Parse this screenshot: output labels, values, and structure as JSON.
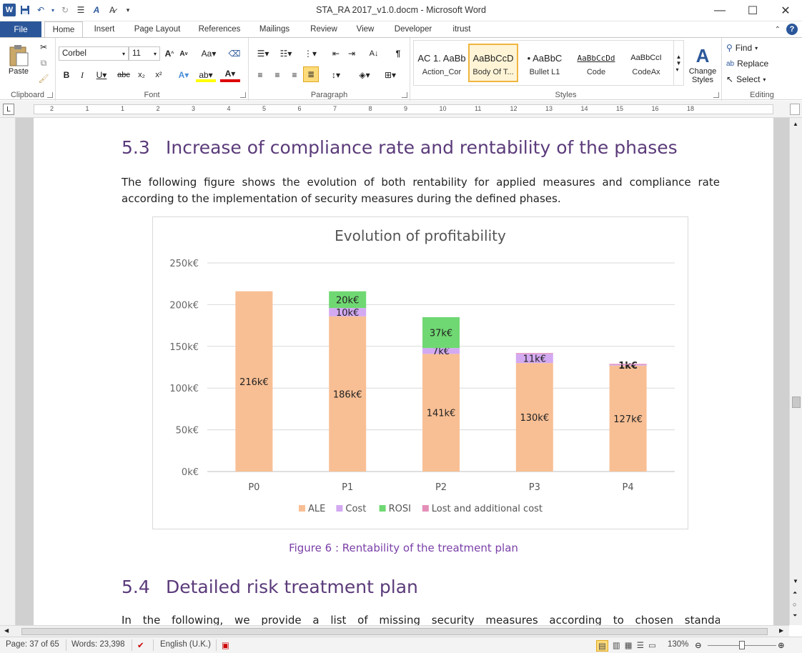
{
  "window": {
    "title": "STA_RA 2017_v1.0.docm - Microsoft Word",
    "app_icon": "W",
    "controls": {
      "minimize": "—",
      "maximize": "☐",
      "close": "✕"
    }
  },
  "tabs": {
    "file": "File",
    "items": [
      "Home",
      "Insert",
      "Page Layout",
      "References",
      "Mailings",
      "Review",
      "View",
      "Developer",
      "itrust"
    ],
    "active": "Home"
  },
  "ribbon": {
    "clipboard": {
      "label": "Clipboard",
      "paste": "Paste"
    },
    "font": {
      "label": "Font",
      "font_name": "Corbel",
      "font_size": "11"
    },
    "paragraph": {
      "label": "Paragraph"
    },
    "styles": {
      "label": "Styles",
      "tiles": [
        {
          "sample": "AC 1. AaBb",
          "name": "Action_Cor"
        },
        {
          "sample": "AaBbCcD",
          "name": "Body Of T..."
        },
        {
          "sample": "• AaBbC",
          "name": "Bullet L1"
        },
        {
          "sample": "AaBbCcDd",
          "name": "Code"
        },
        {
          "sample": "AaBbCcI",
          "name": "CodeAx"
        }
      ],
      "selected_index": 1,
      "change_styles": "Change Styles"
    },
    "editing": {
      "label": "Editing",
      "find": "Find",
      "replace": "Replace",
      "select": "Select"
    }
  },
  "ruler": {
    "numbers": [
      "2",
      "1",
      "1",
      "2",
      "3",
      "4",
      "5",
      "6",
      "7",
      "8",
      "9",
      "10",
      "11",
      "12",
      "13",
      "14",
      "15",
      "16",
      "18"
    ]
  },
  "document": {
    "section1": {
      "number": "5.3",
      "title": "Increase of compliance rate and rentability of the phases"
    },
    "paragraph1": "The following figure shows the evolution of both rentability for applied measures and compliance rate according to the implementation of security measures during the defined phases.",
    "caption": "Figure 6 : Rentability of the treatment plan",
    "section2": {
      "number": "5.4",
      "title": "Detailed risk treatment plan"
    },
    "paragraph2": "In the following, we provide a list of missing security measures according to chosen standard and"
  },
  "chart_data": {
    "type": "bar",
    "stacked": true,
    "title": "Evolution of profitability",
    "categories": [
      "P0",
      "P1",
      "P2",
      "P3",
      "P4"
    ],
    "ylim": [
      0,
      250
    ],
    "yticks": [
      "0k€",
      "50k€",
      "100k€",
      "150k€",
      "200k€",
      "250k€"
    ],
    "grid": true,
    "legend_position": "bottom",
    "series": [
      {
        "name": "ALE",
        "color": "#f8bf94",
        "values": [
          216,
          186,
          141,
          130,
          127
        ],
        "labels": [
          "216k€",
          "186k€",
          "141k€",
          "130k€",
          "127k€"
        ]
      },
      {
        "name": "Cost",
        "color": "#d3a9f2",
        "values": [
          0,
          10,
          7,
          11,
          1
        ],
        "labels": [
          "",
          "10k€",
          "7k€",
          "11k€",
          "1k€"
        ]
      },
      {
        "name": "ROSI",
        "color": "#6fd872",
        "values": [
          0,
          20,
          37,
          0,
          0
        ],
        "labels": [
          "",
          "20k€",
          "37k€",
          "",
          ""
        ]
      },
      {
        "name": "Lost and additional cost",
        "color": "#e38fb8",
        "values": [
          0,
          0,
          0,
          1,
          1
        ],
        "labels": [
          "",
          "",
          "",
          "",
          ""
        ]
      }
    ]
  },
  "status": {
    "page": "Page: 37 of 65",
    "words": "Words: 23,398",
    "language": "English (U.K.)",
    "zoom": "130%"
  }
}
